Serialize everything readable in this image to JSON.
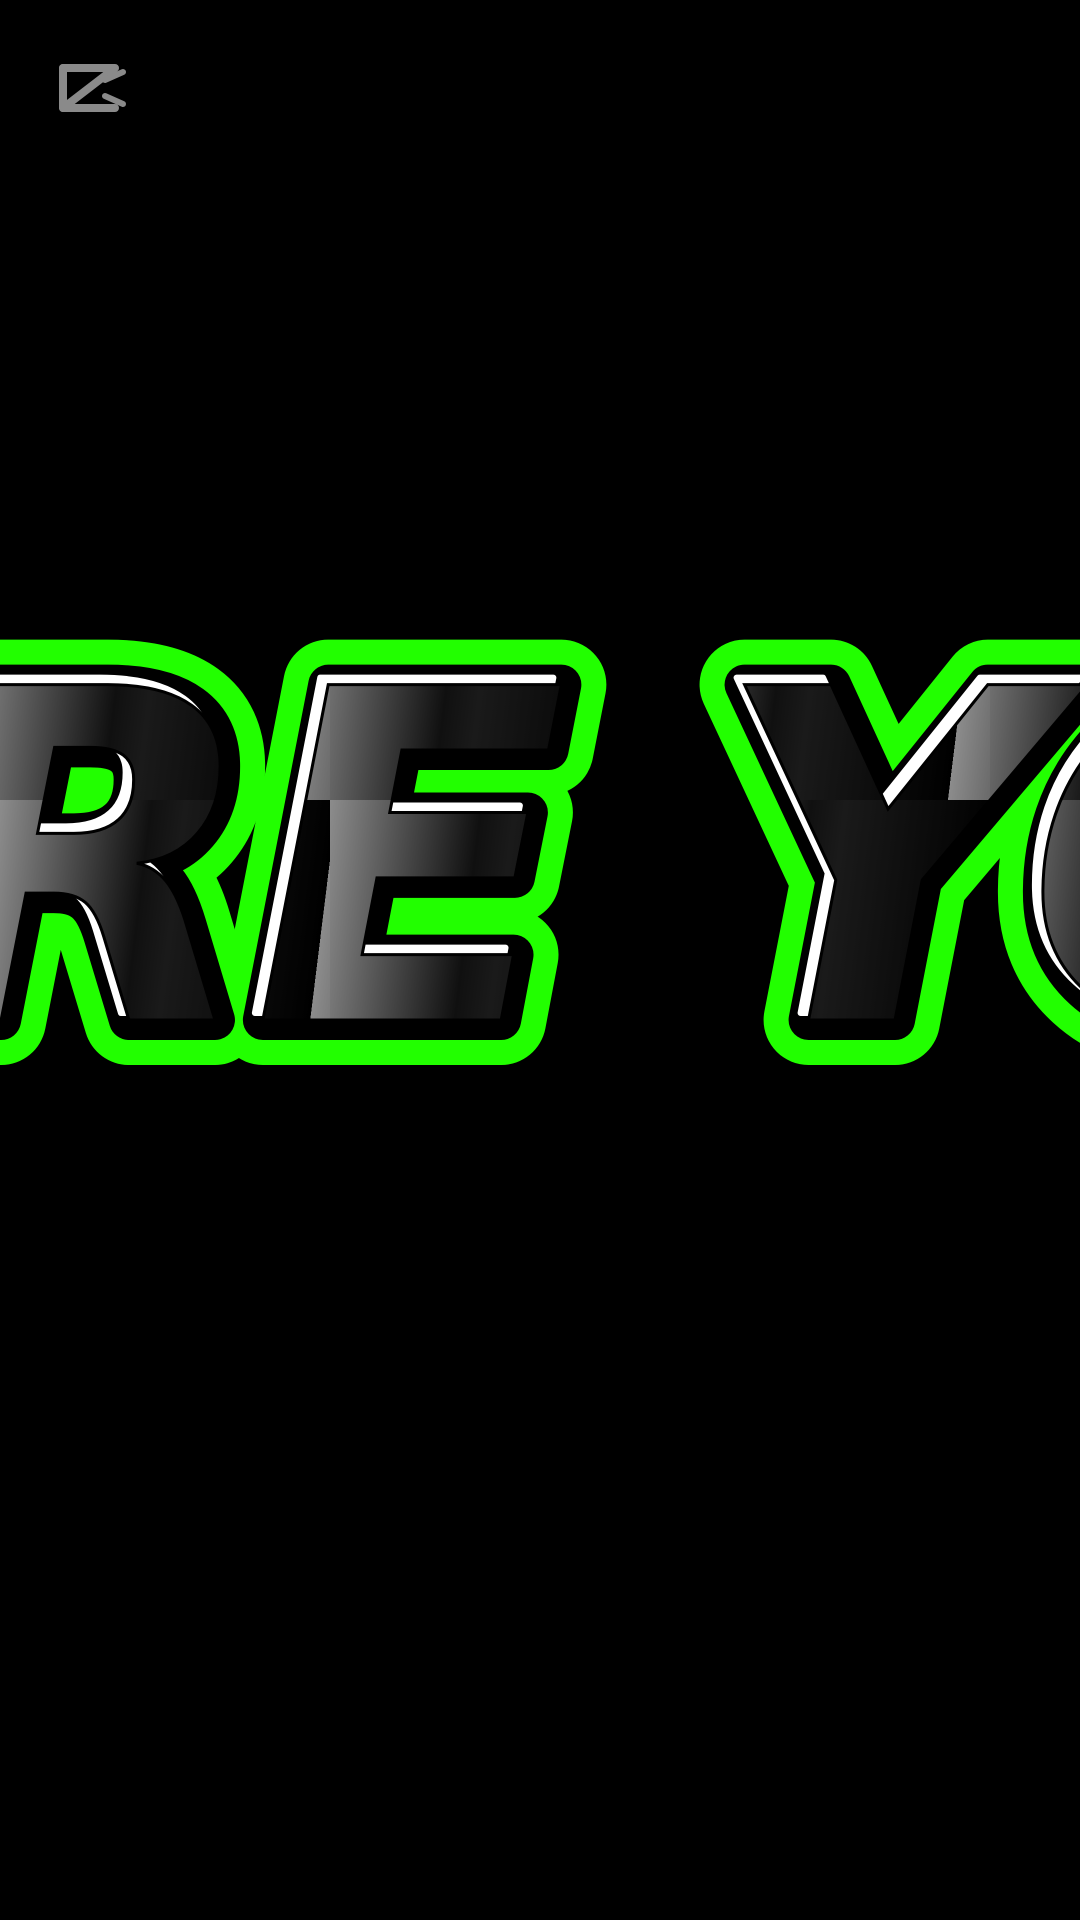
{
  "watermark": {
    "icon": "capcut-logo-icon",
    "color": "#8a8a8a"
  },
  "title": {
    "text": "RE YO",
    "outline_color": "#22ff00",
    "inner_stroke_color": "#000000",
    "highlight_color": "#ffffff",
    "fill_gradient": [
      "#8c8c8c",
      "#0a0a0a",
      "#7a7a7a",
      "#000000"
    ]
  },
  "background_color": "#000000"
}
